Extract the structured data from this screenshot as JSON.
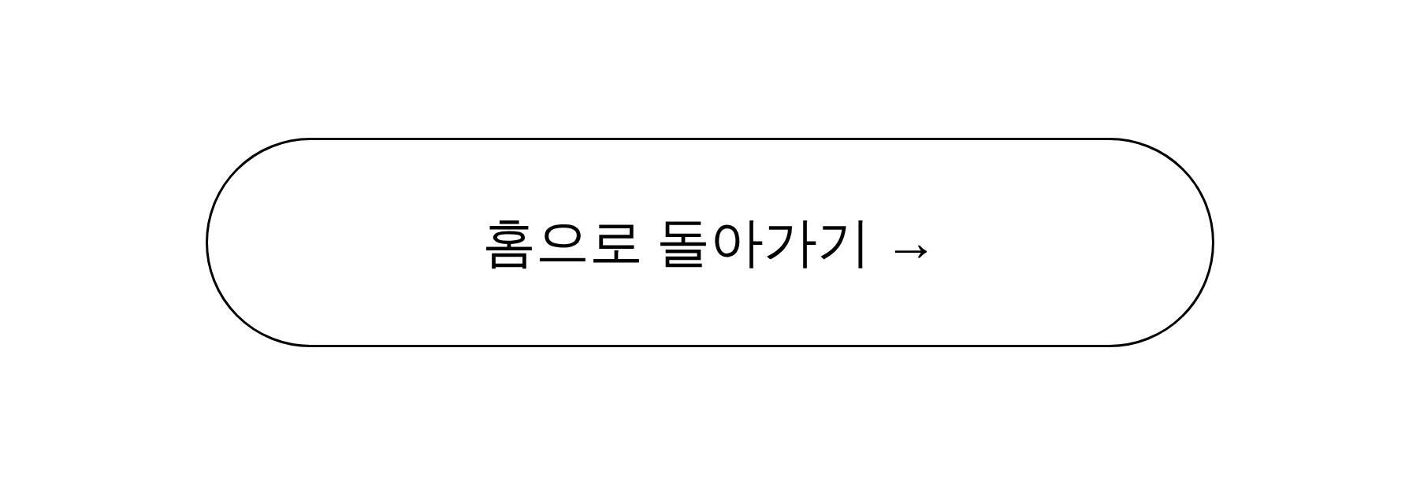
{
  "button": {
    "label": "홈으로 돌아가기 →"
  }
}
